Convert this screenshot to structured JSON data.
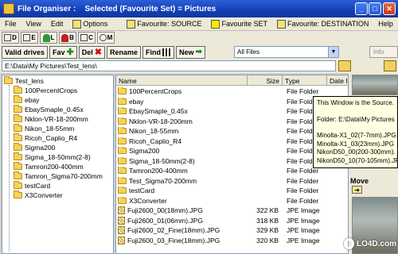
{
  "title_bar": {
    "title": "File Organiser :    Selected (Favourite Set) = Pictures",
    "minimize": "_",
    "maximize": "□",
    "close": "✕"
  },
  "menu": {
    "file": "File",
    "view": "View",
    "edit": "Edit",
    "options": "Options",
    "fav_source": "Favourite: SOURCE",
    "fav_set": "Favourite SET",
    "fav_destination": "Favourite: DESTINATION",
    "help": "Help"
  },
  "toolbar1": {
    "buttons": [
      "D",
      "E",
      "L",
      "B",
      "C",
      "M"
    ]
  },
  "toolbar2": {
    "valid_drives": "Valid drives",
    "fav": "Fav",
    "del": "Del",
    "rename": "Rename",
    "find": "Find",
    "new": "New",
    "filter_value": "All Files",
    "info": "Info"
  },
  "path": {
    "value": "E:\\Data\\My Pictures\\Test_lens\\"
  },
  "tree": {
    "root": "Test_lens",
    "children": [
      "100PercentCrops",
      "ebay",
      "EbaySmaple_0.45x",
      "Nklon-VR-18-200mm",
      "Nikon_18-55mm",
      "Ricoh_Caplio_R4",
      "Sigma200",
      "Sigma_18-50mm(2-8)",
      "Tamron200-400mm",
      "Tamron_Sigma70-200mm",
      "testCard",
      "X3Converter"
    ]
  },
  "filelist": {
    "columns": [
      "Name",
      "Size",
      "Type",
      "Date I"
    ],
    "rows": [
      {
        "name": "100PercentCrops",
        "size": "",
        "type": "File Folder",
        "kind": "folder"
      },
      {
        "name": "ebay",
        "size": "",
        "type": "File Folder",
        "kind": "folder"
      },
      {
        "name": "EbaySmaple_0.45x",
        "size": "",
        "type": "File Folder",
        "kind": "folder"
      },
      {
        "name": "Nklon-VR-18-200mm",
        "size": "",
        "type": "File Folder",
        "kind": "folder"
      },
      {
        "name": "Nikon_18-55mm",
        "size": "",
        "type": "File Folder",
        "kind": "folder"
      },
      {
        "name": "Ricoh_Caplio_R4",
        "size": "",
        "type": "File Folder",
        "kind": "folder"
      },
      {
        "name": "Sigma200",
        "size": "",
        "type": "File Folder",
        "kind": "folder"
      },
      {
        "name": "Sigma_18-50mm(2-8)",
        "size": "",
        "type": "File Folder",
        "kind": "folder"
      },
      {
        "name": "Tamron200-400mm",
        "size": "",
        "type": "File Folder",
        "kind": "folder"
      },
      {
        "name": "Test_Sigma70-200mm",
        "size": "",
        "type": "File Folder",
        "kind": "folder"
      },
      {
        "name": "testCard",
        "size": "",
        "type": "File Folder",
        "kind": "folder"
      },
      {
        "name": "X3Converter",
        "size": "",
        "type": "File Folder",
        "kind": "folder"
      },
      {
        "name": "Fuji2600_00(18mm).JPG",
        "size": "322 KB",
        "type": "JPE Image",
        "kind": "jpg"
      },
      {
        "name": "Fuji2600_01(06mm).JPG",
        "size": "318 KB",
        "type": "JPE Image",
        "kind": "jpg"
      },
      {
        "name": "Fuji2600_02_Fine(18mm).JPG",
        "size": "329 KB",
        "type": "JPE Image",
        "kind": "jpg"
      },
      {
        "name": "Fuji2600_03_Fine(18mm).JPG",
        "size": "320 KB",
        "type": "JPE Image",
        "kind": "jpg"
      }
    ]
  },
  "tooltip": {
    "line1": "This Window is the Source.",
    "line2": "Folder: E:\\Data\\My Pictures",
    "files": [
      "Minolta-X1_02(7-7mm).JPG",
      "Minolta-X1_03(23mm).JPG",
      "NikonD50_00(200-300mm).",
      "NikonD50_10(70-105mm).JPG"
    ]
  },
  "right_panel": {
    "move_label": "Move"
  },
  "watermark": "LO4D.com"
}
